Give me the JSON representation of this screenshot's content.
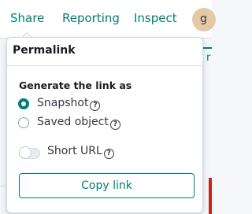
{
  "topnav": {
    "share_label": "Share",
    "reporting_label": "Reporting",
    "inspect_label": "Inspect",
    "avatar_letter": "g"
  },
  "background": {
    "partial_text": "r"
  },
  "popover": {
    "title": "Permalink",
    "generate_label": "Generate the link as",
    "options": [
      {
        "label": "Snapshot",
        "checked": true
      },
      {
        "label": "Saved object",
        "checked": false
      }
    ],
    "short_url_label": "Short URL",
    "short_url_enabled": false,
    "copy_button_label": "Copy link",
    "help_glyph": "?"
  },
  "colors": {
    "accent": "#017d73",
    "text": "#343741",
    "border": "#d3dae6",
    "avatar_bg": "#e4c9a4",
    "danger": "#bd271e"
  }
}
